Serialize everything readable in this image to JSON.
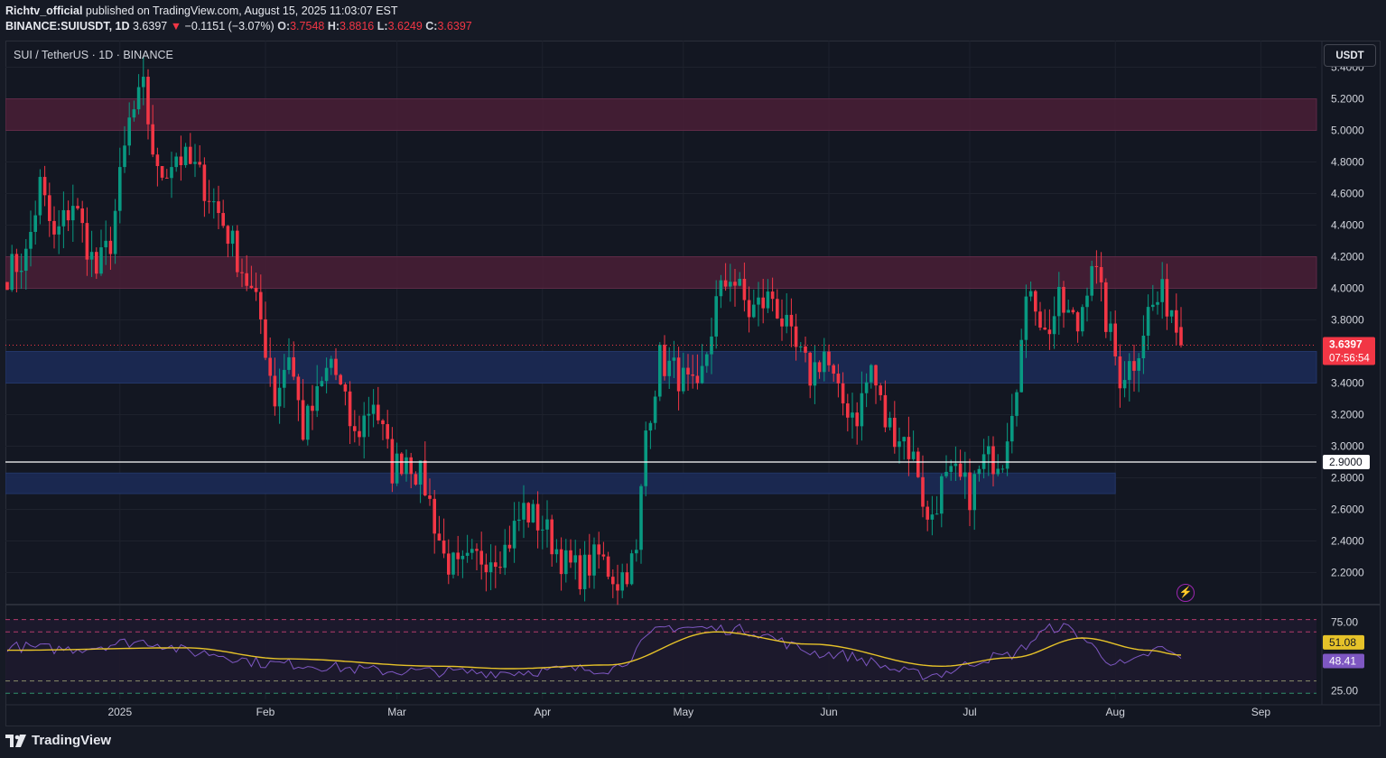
{
  "header": {
    "author": "Richtv_official",
    "published_text": "published on TradingView.com, August 15, 2025 11:03:07 EST",
    "symbol_line": "BINANCE:SUIUSDT, 1D",
    "last_price": "3.6397",
    "change_arrow": "▼",
    "change": "−0.1151 (−3.07%)",
    "open_label": "O:",
    "open": "3.7548",
    "high_label": "H:",
    "high": "3.8816",
    "low_label": "L:",
    "low": "3.6249",
    "close_label": "C:",
    "close": "3.6397"
  },
  "symbol_title": "SUI / TetherUS · 1D · BINANCE",
  "currency_button": "USDT",
  "footer_brand": "TradingView",
  "colors": {
    "up": "#089981",
    "down": "#f23645",
    "resistance_zone": "#4a1f37",
    "support_zone": "#1b2a55",
    "rsi_line": "#7e57c2",
    "rsi_ma": "#e6c229",
    "price_tag": "#f23645",
    "level_line": "#ffffff"
  },
  "chart_data": [
    {
      "type": "candlestick",
      "title": "SUI / TetherUS · 1D · BINANCE",
      "ylim": [
        2.1,
        5.5
      ],
      "y_ticks": [
        "5.4000",
        "5.2000",
        "5.0000",
        "4.8000",
        "4.6000",
        "4.4000",
        "4.2000",
        "4.0000",
        "3.8000",
        "3.6000",
        "3.4000",
        "3.2000",
        "3.0000",
        "2.8000",
        "2.6000",
        "2.4000",
        "2.2000"
      ],
      "x_ticks": [
        "2025",
        "Feb",
        "Mar",
        "Apr",
        "May",
        "Jun",
        "Jul",
        "Aug",
        "Sep"
      ],
      "date_range": [
        "2024-12-08",
        "2025-08-15"
      ],
      "current_price": "3.6397",
      "countdown": "07:56:54",
      "horizontal_line": "2.9000",
      "zones": [
        {
          "kind": "resistance",
          "from": 5.0,
          "to": 5.2
        },
        {
          "kind": "resistance",
          "from": 4.0,
          "to": 4.2
        },
        {
          "kind": "support",
          "from": 3.4,
          "to": 3.6
        },
        {
          "kind": "support",
          "from": 2.7,
          "to": 2.83,
          "end": "2025-08-01"
        }
      ],
      "anchors": [
        {
          "date": "2024-12-08",
          "close": 4.1
        },
        {
          "date": "2024-12-12",
          "close": 4.2
        },
        {
          "date": "2024-12-15",
          "close": 4.65
        },
        {
          "date": "2024-12-18",
          "close": 4.3
        },
        {
          "date": "2024-12-22",
          "close": 4.55
        },
        {
          "date": "2024-12-27",
          "close": 4.1
        },
        {
          "date": "2024-12-30",
          "close": 4.3
        },
        {
          "date": "2025-01-03",
          "close": 5.05
        },
        {
          "date": "2025-01-06",
          "close": 5.25
        },
        {
          "date": "2025-01-09",
          "close": 4.7
        },
        {
          "date": "2025-01-13",
          "close": 4.85
        },
        {
          "date": "2025-01-17",
          "close": 4.75
        },
        {
          "date": "2025-01-20",
          "close": 4.6
        },
        {
          "date": "2025-01-24",
          "close": 4.35
        },
        {
          "date": "2025-01-28",
          "close": 4.05
        },
        {
          "date": "2025-01-31",
          "close": 3.8
        },
        {
          "date": "2025-02-03",
          "close": 3.3
        },
        {
          "date": "2025-02-06",
          "close": 3.6
        },
        {
          "date": "2025-02-09",
          "close": 3.1
        },
        {
          "date": "2025-02-12",
          "close": 3.3
        },
        {
          "date": "2025-02-15",
          "close": 3.55
        },
        {
          "date": "2025-02-20",
          "close": 3.05
        },
        {
          "date": "2025-02-24",
          "close": 3.3
        },
        {
          "date": "2025-02-28",
          "close": 2.85
        },
        {
          "date": "2025-03-03",
          "close": 2.95
        },
        {
          "date": "2025-03-07",
          "close": 2.75
        },
        {
          "date": "2025-03-11",
          "close": 2.3
        },
        {
          "date": "2025-03-14",
          "close": 2.2
        },
        {
          "date": "2025-03-19",
          "close": 2.3
        },
        {
          "date": "2025-03-24",
          "close": 2.35
        },
        {
          "date": "2025-03-28",
          "close": 2.6
        },
        {
          "date": "2025-04-01",
          "close": 2.5
        },
        {
          "date": "2025-04-06",
          "close": 2.25
        },
        {
          "date": "2025-04-09",
          "close": 2.2
        },
        {
          "date": "2025-04-13",
          "close": 2.3
        },
        {
          "date": "2025-04-17",
          "close": 2.15
        },
        {
          "date": "2025-04-21",
          "close": 2.3
        },
        {
          "date": "2025-04-23",
          "close": 3.1
        },
        {
          "date": "2025-04-26",
          "close": 3.55
        },
        {
          "date": "2025-04-30",
          "close": 3.45
        },
        {
          "date": "2025-05-04",
          "close": 3.3
        },
        {
          "date": "2025-05-08",
          "close": 3.9
        },
        {
          "date": "2025-05-11",
          "close": 4.1
        },
        {
          "date": "2025-05-15",
          "close": 3.85
        },
        {
          "date": "2025-05-20",
          "close": 3.95
        },
        {
          "date": "2025-05-24",
          "close": 3.65
        },
        {
          "date": "2025-05-28",
          "close": 3.45
        },
        {
          "date": "2025-05-31",
          "close": 3.6
        },
        {
          "date": "2025-06-03",
          "close": 3.3
        },
        {
          "date": "2025-06-07",
          "close": 3.2
        },
        {
          "date": "2025-06-10",
          "close": 3.5
        },
        {
          "date": "2025-06-13",
          "close": 3.15
        },
        {
          "date": "2025-06-17",
          "close": 3.05
        },
        {
          "date": "2025-06-20",
          "close": 2.85
        },
        {
          "date": "2025-06-22",
          "close": 2.5
        },
        {
          "date": "2025-06-25",
          "close": 2.75
        },
        {
          "date": "2025-06-28",
          "close": 2.8
        },
        {
          "date": "2025-07-01",
          "close": 2.7
        },
        {
          "date": "2025-07-04",
          "close": 2.9
        },
        {
          "date": "2025-07-08",
          "close": 2.95
        },
        {
          "date": "2025-07-11",
          "close": 3.45
        },
        {
          "date": "2025-07-14",
          "close": 4.05
        },
        {
          "date": "2025-07-17",
          "close": 3.7
        },
        {
          "date": "2025-07-20",
          "close": 3.9
        },
        {
          "date": "2025-07-24",
          "close": 3.75
        },
        {
          "date": "2025-07-27",
          "close": 4.2
        },
        {
          "date": "2025-07-30",
          "close": 3.8
        },
        {
          "date": "2025-08-02",
          "close": 3.45
        },
        {
          "date": "2025-08-05",
          "close": 3.55
        },
        {
          "date": "2025-08-08",
          "close": 3.85
        },
        {
          "date": "2025-08-11",
          "close": 3.95
        },
        {
          "date": "2025-08-13",
          "close": 3.88
        },
        {
          "date": "2025-08-15",
          "close": 3.64
        }
      ]
    },
    {
      "type": "line",
      "title": "RSI",
      "ylim": [
        15,
        90
      ],
      "y_ticks": [
        "75.00",
        "25.00"
      ],
      "levels": [
        80,
        70,
        30,
        20
      ],
      "series": [
        {
          "name": "RSI",
          "last": "48.41",
          "anchors": [
            {
              "date": "2024-12-08",
              "value": 58
            },
            {
              "date": "2024-12-20",
              "value": 56
            },
            {
              "date": "2025-01-06",
              "value": 62
            },
            {
              "date": "2025-01-18",
              "value": 53
            },
            {
              "date": "2025-02-03",
              "value": 44
            },
            {
              "date": "2025-03-01",
              "value": 38
            },
            {
              "date": "2025-03-20",
              "value": 37
            },
            {
              "date": "2025-04-15",
              "value": 40
            },
            {
              "date": "2025-04-28",
              "value": 74
            },
            {
              "date": "2025-05-12",
              "value": 72
            },
            {
              "date": "2025-06-01",
              "value": 52
            },
            {
              "date": "2025-06-22",
              "value": 35
            },
            {
              "date": "2025-07-08",
              "value": 50
            },
            {
              "date": "2025-07-20",
              "value": 74
            },
            {
              "date": "2025-08-03",
              "value": 43
            },
            {
              "date": "2025-08-11",
              "value": 56
            },
            {
              "date": "2025-08-15",
              "value": 48.41
            }
          ]
        },
        {
          "name": "RSI-based MA",
          "last": "51.08",
          "anchors": [
            {
              "date": "2024-12-08",
              "value": 55
            },
            {
              "date": "2025-01-15",
              "value": 57
            },
            {
              "date": "2025-02-05",
              "value": 48
            },
            {
              "date": "2025-03-10",
              "value": 42
            },
            {
              "date": "2025-03-25",
              "value": 40
            },
            {
              "date": "2025-04-15",
              "value": 43
            },
            {
              "date": "2025-05-08",
              "value": 70
            },
            {
              "date": "2025-05-28",
              "value": 60
            },
            {
              "date": "2025-06-25",
              "value": 42
            },
            {
              "date": "2025-07-10",
              "value": 49
            },
            {
              "date": "2025-07-25",
              "value": 65
            },
            {
              "date": "2025-08-08",
              "value": 55
            },
            {
              "date": "2025-08-15",
              "value": 51.08
            }
          ]
        }
      ]
    }
  ]
}
